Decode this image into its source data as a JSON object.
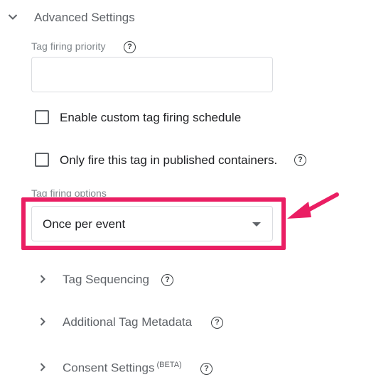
{
  "advanced": {
    "title": "Advanced Settings",
    "expanded": true
  },
  "priority": {
    "label": "Tag firing priority",
    "value": "",
    "placeholder": ""
  },
  "custom_schedule": {
    "label": "Enable custom tag firing schedule",
    "checked": false
  },
  "published_only": {
    "label": "Only fire this tag in published containers.",
    "checked": false
  },
  "firing_options": {
    "label": "Tag firing options",
    "selected": "Once per event"
  },
  "sections": [
    {
      "title": "Tag Sequencing"
    },
    {
      "title": "Additional Tag Metadata"
    },
    {
      "title": "Consent Settings",
      "badge": "(BETA)"
    }
  ],
  "colors": {
    "highlight": "#ea1e63",
    "text": "#202124",
    "muted": "#5f6368",
    "border": "#dadce0"
  },
  "icons": {
    "help": "help-circle-icon",
    "expand": "chevron-down-icon",
    "collapse": "chevron-right-icon",
    "dropdown": "caret-down-icon",
    "annotation": "arrow-annotation-icon"
  },
  "help_glyph": "?"
}
